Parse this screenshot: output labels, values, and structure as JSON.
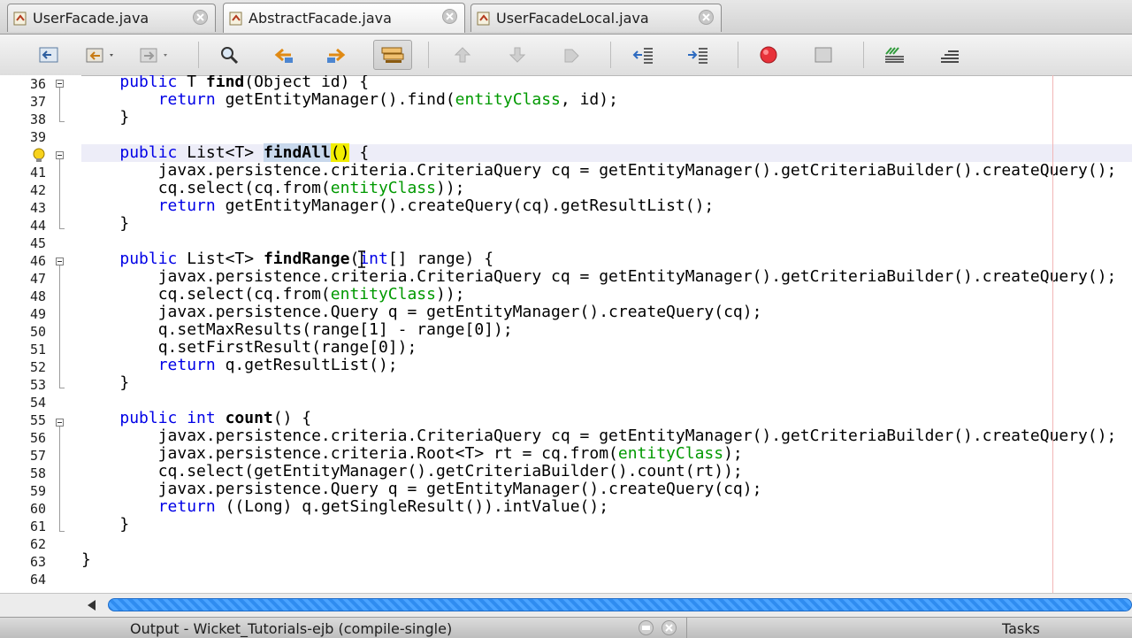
{
  "tabs": [
    {
      "label": "UserFacade.java",
      "active": false
    },
    {
      "label": "AbstractFacade.java",
      "active": true
    },
    {
      "label": "UserFacadeLocal.java",
      "active": false
    }
  ],
  "toolbar": {
    "icons": [
      "back-icon",
      "last-edit-icon",
      "forward-icon",
      "find-icon",
      "find-previous-icon",
      "find-next-icon",
      "toggle-highlight-icon",
      "previous-bookmark-icon",
      "next-bookmark-icon",
      "toggle-bookmark-icon",
      "shift-left-icon",
      "shift-right-icon",
      "record-macro-icon",
      "stop-macro-icon",
      "comment-icon",
      "uncomment-icon"
    ]
  },
  "editor": {
    "line_numbers": [
      "36",
      "37",
      "38",
      "39",
      "",
      "41",
      "42",
      "43",
      "44",
      "45",
      "46",
      "47",
      "48",
      "49",
      "50",
      "51",
      "52",
      "53",
      "54",
      "55",
      "56",
      "57",
      "58",
      "59",
      "60",
      "61",
      "62",
      "63",
      "64"
    ],
    "colors": {
      "keyword": "#0000e6",
      "field": "#009900",
      "margin": "#f2b6b6"
    }
  },
  "status": {
    "output_label": "Output - Wicket_Tutorials-ejb (compile-single)",
    "tasks_label": "Tasks"
  }
}
